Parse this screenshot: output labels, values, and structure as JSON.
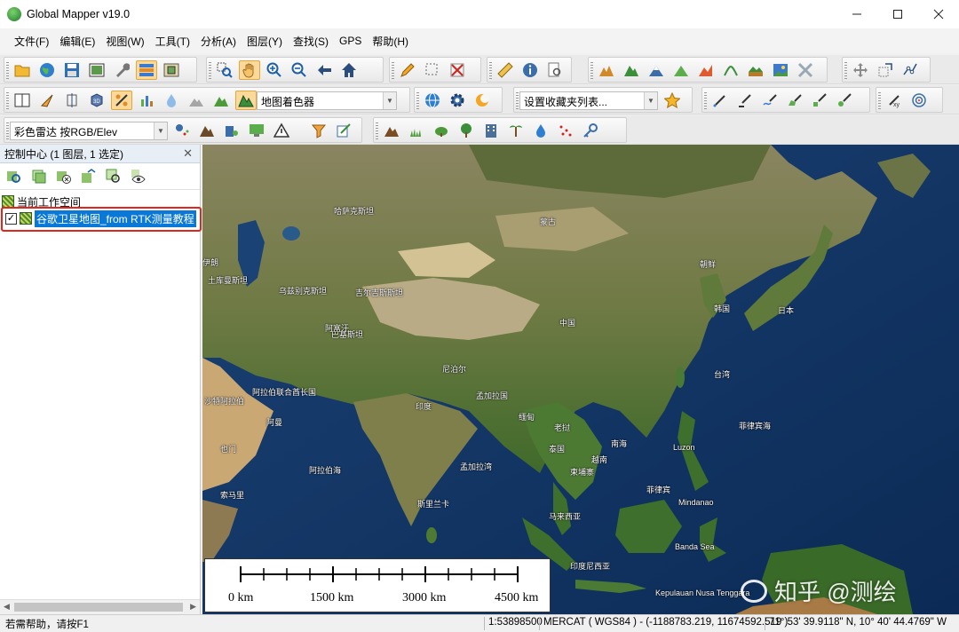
{
  "window": {
    "title": "Global Mapper v19.0",
    "min_icon": "minimize-icon",
    "max_icon": "maximize-icon",
    "close_icon": "close-icon"
  },
  "menu": [
    "文件(F)",
    "编辑(E)",
    "视图(W)",
    "工具(T)",
    "分析(A)",
    "图层(Y)",
    "查找(S)",
    "GPS",
    "帮助(H)"
  ],
  "toolbar": {
    "shader_select": "地图着色器",
    "favorites_select": "设置收藏夹列表...",
    "elev_select": "彩色雷达 按RGB/Elev"
  },
  "control_center": {
    "title": "控制中心 (1 图层,  1 选定)",
    "workspace_label": "当前工作空间",
    "layer_label": "谷歌卫星地图_from RTK测量教程",
    "layer_checked": true
  },
  "map": {
    "labels": {
      "china": "中国",
      "mongolia": "蒙古",
      "kazakhstan": "哈萨克斯坦",
      "india": "印度",
      "japan": "日本",
      "korea": "韩国",
      "philippines": "菲律宾",
      "thailand": "泰国",
      "vietnam": "越南",
      "myanmar": "缅甸",
      "pakistan": "巴基斯坦",
      "afghanistan": "阿富汗",
      "iran": "伊朗",
      "turkmenistan": "土库曼斯坦",
      "uzbekistan": "乌兹别克斯坦",
      "kyrgyzstan": "吉尔吉斯斯坦",
      "nepal": "尼泊尔",
      "bangladesh": "孟加拉国",
      "malaysia": "马来西亚",
      "indonesia": "印度尼西亚",
      "sri_lanka": "斯里兰卡",
      "oman": "阿曼",
      "uae": "阿拉伯联合酋长国",
      "saudi": "沙特阿拉伯",
      "yemen": "也门",
      "somalia": "索马里",
      "taiwan": "台湾",
      "laos": "老挝",
      "cambodia": "柬埔寨",
      "north_korea": "朝鲜",
      "bay_of_bengal": "孟加拉湾",
      "arabian_sea": "阿拉伯海",
      "south_china_sea": "南海",
      "pacific": "菲律宾海",
      "mindanao": "Mindanao",
      "luzon": "Luzon",
      "banda_sea": "Banda Sea",
      "nusa_tenggara": "Kepulauan Nusa Tenggara"
    },
    "scalebar": {
      "labels": [
        "0 km",
        "1500 km",
        "3000 km",
        "4500 km"
      ]
    },
    "watermark": "知乎 @测绘"
  },
  "statusbar": {
    "help": "若需帮助，请按F1",
    "scale": "1:53898500",
    "projection": "MERCAT ( WGS84 ) - (-1188783.219, 11674592.519 )",
    "coords": "71° 53' 39.9118\" N, 10° 40' 44.4769\" W"
  },
  "colors": {
    "selection": "#0a78d7",
    "highlight_border": "#e1261c",
    "ocean": "#12325e",
    "land": "#8a7a55"
  }
}
